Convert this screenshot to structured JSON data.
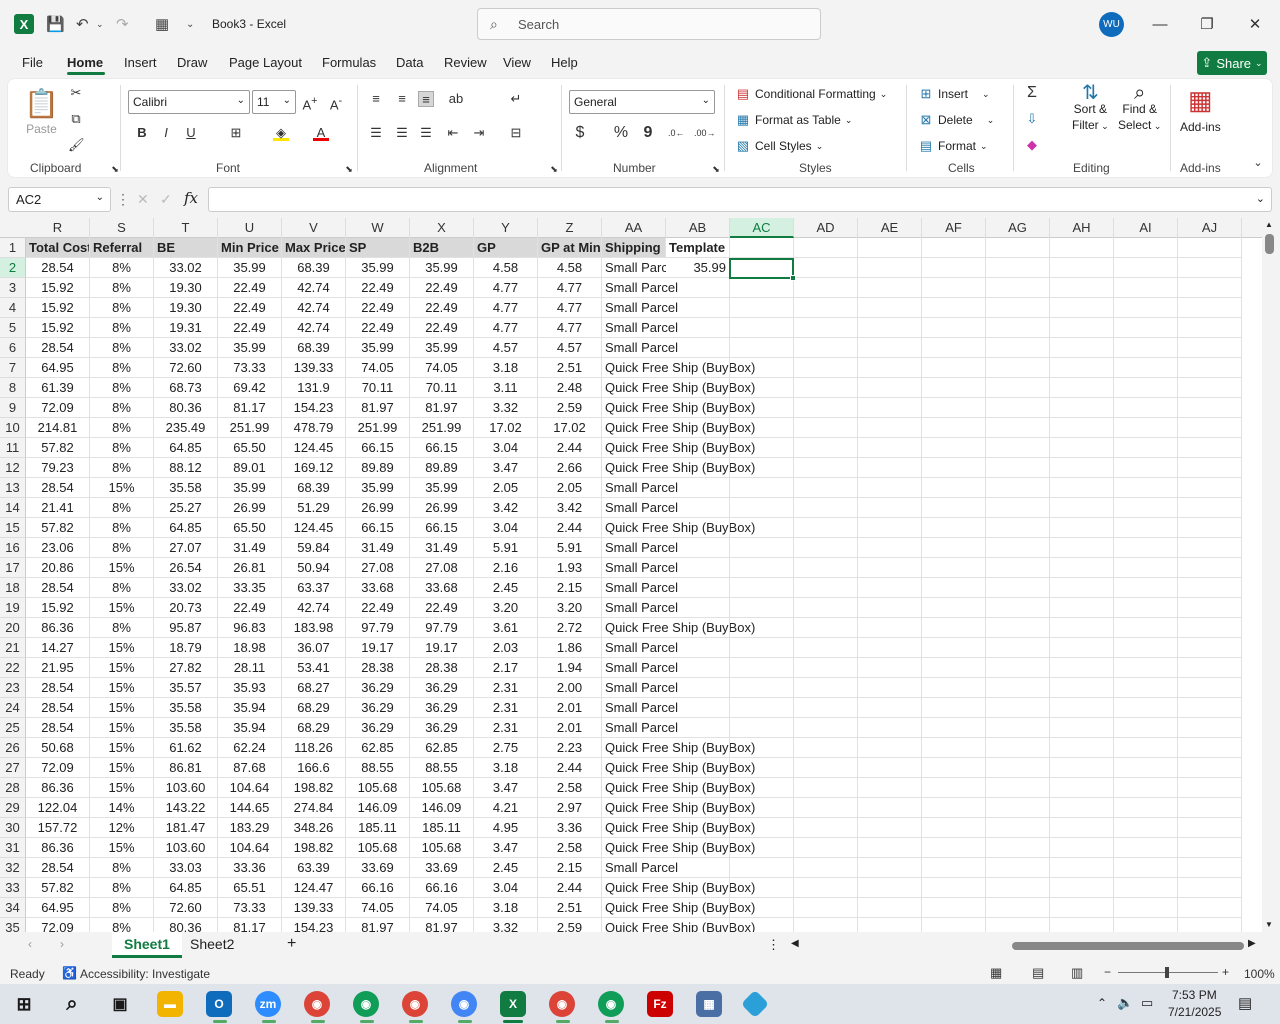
{
  "app": {
    "doc_title": "Book3  -  Excel",
    "avatar": "WU",
    "share_label": "Share"
  },
  "search": {
    "placeholder": "Search"
  },
  "menu": [
    "File",
    "Home",
    "Insert",
    "Draw",
    "Page Layout",
    "Formulas",
    "Data",
    "Review",
    "View",
    "Help"
  ],
  "ribbon": {
    "clipboard": {
      "paste": "Paste",
      "label": "Clipboard"
    },
    "font": {
      "family": "Calibri",
      "size": "11",
      "label": "Font",
      "bold": "B",
      "italic": "I",
      "underline": "U"
    },
    "alignment": {
      "label": "Alignment"
    },
    "number": {
      "format": "General",
      "label": "Number",
      "currency": "$",
      "percent": "%",
      "comma": "9"
    },
    "styles": {
      "conditional": "Conditional Formatting",
      "format_table": "Format as Table",
      "cell_styles": "Cell Styles",
      "label": "Styles"
    },
    "cells": {
      "insert": "Insert",
      "delete": "Delete",
      "format": "Format",
      "label": "Cells"
    },
    "editing": {
      "sort": "Sort &",
      "filter": "Filter",
      "find": "Find &",
      "select": "Select",
      "label": "Editing"
    },
    "addins": {
      "name": "Add-ins",
      "label": "Add-ins"
    }
  },
  "formula": {
    "namebox": "AC2",
    "fx": "fx",
    "content": ""
  },
  "columns": [
    "R",
    "S",
    "T",
    "U",
    "V",
    "W",
    "X",
    "Y",
    "Z",
    "AA",
    "AB",
    "AC",
    "AD",
    "AE",
    "AF",
    "AG",
    "AH",
    "AI",
    "AJ"
  ],
  "selected_cell": "AC2",
  "headers": {
    "R": "Total Cost",
    "S": "Referral",
    "T": "BE",
    "U": "Min Price",
    "V": "Max Price",
    "W": "SP",
    "X": "B2B",
    "Y": "GP",
    "Z": "GP at Min",
    "AA": "Shipping",
    "AB": "Template"
  },
  "rows": [
    [
      "28.54",
      "8%",
      "33.02",
      "35.99",
      "68.39",
      "35.99",
      "35.99",
      "4.58",
      "4.58",
      "Small Parcel",
      "35.99"
    ],
    [
      "15.92",
      "8%",
      "19.30",
      "22.49",
      "42.74",
      "22.49",
      "22.49",
      "4.77",
      "4.77",
      "Small Parcel",
      ""
    ],
    [
      "15.92",
      "8%",
      "19.30",
      "22.49",
      "42.74",
      "22.49",
      "22.49",
      "4.77",
      "4.77",
      "Small Parcel",
      ""
    ],
    [
      "15.92",
      "8%",
      "19.31",
      "22.49",
      "42.74",
      "22.49",
      "22.49",
      "4.77",
      "4.77",
      "Small Parcel",
      ""
    ],
    [
      "28.54",
      "8%",
      "33.02",
      "35.99",
      "68.39",
      "35.99",
      "35.99",
      "4.57",
      "4.57",
      "Small Parcel",
      ""
    ],
    [
      "64.95",
      "8%",
      "72.60",
      "73.33",
      "139.33",
      "74.05",
      "74.05",
      "3.18",
      "2.51",
      "Quick Free Ship (BuyBox)",
      ""
    ],
    [
      "61.39",
      "8%",
      "68.73",
      "69.42",
      "131.9",
      "70.11",
      "70.11",
      "3.11",
      "2.48",
      "Quick Free Ship (BuyBox)",
      ""
    ],
    [
      "72.09",
      "8%",
      "80.36",
      "81.17",
      "154.23",
      "81.97",
      "81.97",
      "3.32",
      "2.59",
      "Quick Free Ship (BuyBox)",
      ""
    ],
    [
      "214.81",
      "8%",
      "235.49",
      "251.99",
      "478.79",
      "251.99",
      "251.99",
      "17.02",
      "17.02",
      "Quick Free Ship (BuyBox)",
      ""
    ],
    [
      "57.82",
      "8%",
      "64.85",
      "65.50",
      "124.45",
      "66.15",
      "66.15",
      "3.04",
      "2.44",
      "Quick Free Ship (BuyBox)",
      ""
    ],
    [
      "79.23",
      "8%",
      "88.12",
      "89.01",
      "169.12",
      "89.89",
      "89.89",
      "3.47",
      "2.66",
      "Quick Free Ship (BuyBox)",
      ""
    ],
    [
      "28.54",
      "15%",
      "35.58",
      "35.99",
      "68.39",
      "35.99",
      "35.99",
      "2.05",
      "2.05",
      "Small Parcel",
      ""
    ],
    [
      "21.41",
      "8%",
      "25.27",
      "26.99",
      "51.29",
      "26.99",
      "26.99",
      "3.42",
      "3.42",
      "Small Parcel",
      ""
    ],
    [
      "57.82",
      "8%",
      "64.85",
      "65.50",
      "124.45",
      "66.15",
      "66.15",
      "3.04",
      "2.44",
      "Quick Free Ship (BuyBox)",
      ""
    ],
    [
      "23.06",
      "8%",
      "27.07",
      "31.49",
      "59.84",
      "31.49",
      "31.49",
      "5.91",
      "5.91",
      "Small Parcel",
      ""
    ],
    [
      "20.86",
      "15%",
      "26.54",
      "26.81",
      "50.94",
      "27.08",
      "27.08",
      "2.16",
      "1.93",
      "Small Parcel",
      ""
    ],
    [
      "28.54",
      "8%",
      "33.02",
      "33.35",
      "63.37",
      "33.68",
      "33.68",
      "2.45",
      "2.15",
      "Small Parcel",
      ""
    ],
    [
      "15.92",
      "15%",
      "20.73",
      "22.49",
      "42.74",
      "22.49",
      "22.49",
      "3.20",
      "3.20",
      "Small Parcel",
      ""
    ],
    [
      "86.36",
      "8%",
      "95.87",
      "96.83",
      "183.98",
      "97.79",
      "97.79",
      "3.61",
      "2.72",
      "Quick Free Ship (BuyBox)",
      ""
    ],
    [
      "14.27",
      "15%",
      "18.79",
      "18.98",
      "36.07",
      "19.17",
      "19.17",
      "2.03",
      "1.86",
      "Small Parcel",
      ""
    ],
    [
      "21.95",
      "15%",
      "27.82",
      "28.11",
      "53.41",
      "28.38",
      "28.38",
      "2.17",
      "1.94",
      "Small Parcel",
      ""
    ],
    [
      "28.54",
      "15%",
      "35.57",
      "35.93",
      "68.27",
      "36.29",
      "36.29",
      "2.31",
      "2.00",
      "Small Parcel",
      ""
    ],
    [
      "28.54",
      "15%",
      "35.58",
      "35.94",
      "68.29",
      "36.29",
      "36.29",
      "2.31",
      "2.01",
      "Small Parcel",
      ""
    ],
    [
      "28.54",
      "15%",
      "35.58",
      "35.94",
      "68.29",
      "36.29",
      "36.29",
      "2.31",
      "2.01",
      "Small Parcel",
      ""
    ],
    [
      "50.68",
      "15%",
      "61.62",
      "62.24",
      "118.26",
      "62.85",
      "62.85",
      "2.75",
      "2.23",
      "Quick Free Ship (BuyBox)",
      ""
    ],
    [
      "72.09",
      "15%",
      "86.81",
      "87.68",
      "166.6",
      "88.55",
      "88.55",
      "3.18",
      "2.44",
      "Quick Free Ship (BuyBox)",
      ""
    ],
    [
      "86.36",
      "15%",
      "103.60",
      "104.64",
      "198.82",
      "105.68",
      "105.68",
      "3.47",
      "2.58",
      "Quick Free Ship (BuyBox)",
      ""
    ],
    [
      "122.04",
      "14%",
      "143.22",
      "144.65",
      "274.84",
      "146.09",
      "146.09",
      "4.21",
      "2.97",
      "Quick Free Ship (BuyBox)",
      ""
    ],
    [
      "157.72",
      "12%",
      "181.47",
      "183.29",
      "348.26",
      "185.11",
      "185.11",
      "4.95",
      "3.36",
      "Quick Free Ship (BuyBox)",
      ""
    ],
    [
      "86.36",
      "15%",
      "103.60",
      "104.64",
      "198.82",
      "105.68",
      "105.68",
      "3.47",
      "2.58",
      "Quick Free Ship (BuyBox)",
      ""
    ],
    [
      "28.54",
      "8%",
      "33.03",
      "33.36",
      "63.39",
      "33.69",
      "33.69",
      "2.45",
      "2.15",
      "Small Parcel",
      ""
    ],
    [
      "57.82",
      "8%",
      "64.85",
      "65.51",
      "124.47",
      "66.16",
      "66.16",
      "3.04",
      "2.44",
      "Quick Free Ship (BuyBox)",
      ""
    ],
    [
      "64.95",
      "8%",
      "72.60",
      "73.33",
      "139.33",
      "74.05",
      "74.05",
      "3.18",
      "2.51",
      "Quick Free Ship (BuyBox)",
      ""
    ],
    [
      "72.09",
      "8%",
      "80.36",
      "81.17",
      "154.23",
      "81.97",
      "81.97",
      "3.32",
      "2.59",
      "Quick Free Ship (BuyBox)",
      ""
    ]
  ],
  "sheets": [
    "Sheet1",
    "Sheet2"
  ],
  "status": {
    "ready": "Ready",
    "accessibility": "Accessibility: Investigate",
    "zoom": "100%"
  },
  "clock": {
    "time": "7:53 PM",
    "date": "7/21/2025"
  }
}
